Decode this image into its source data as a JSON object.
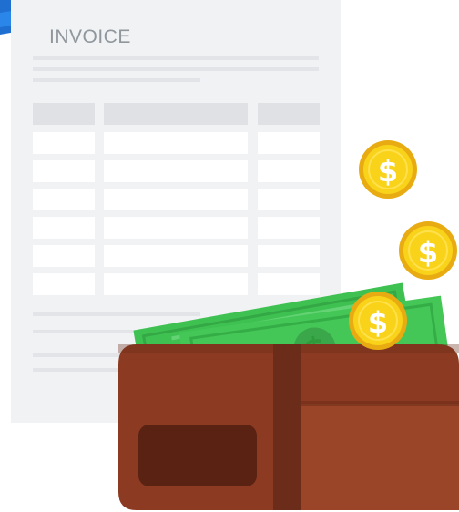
{
  "invoice": {
    "title": "INVOICE",
    "table": {
      "header_columns": 3,
      "rows": 6
    }
  },
  "money": {
    "currency_symbol": "$"
  },
  "colors": {
    "document": "#f1f2f4",
    "document_lines": "#e2e4e7",
    "table_header": "#dfe1e4",
    "accent_blue": "#1f6fd1",
    "bill_green": "#3fc152",
    "bill_dark": "#2f9a3c",
    "wallet_brown": "#8c3b22",
    "wallet_light": "#9b4528",
    "wallet_dark": "#6b2c19",
    "wallet_pocket": "#5a2213",
    "coin_gold": "#f9d21a",
    "coin_rim": "#ffe14d",
    "coin_shadow": "#e8ac12"
  }
}
